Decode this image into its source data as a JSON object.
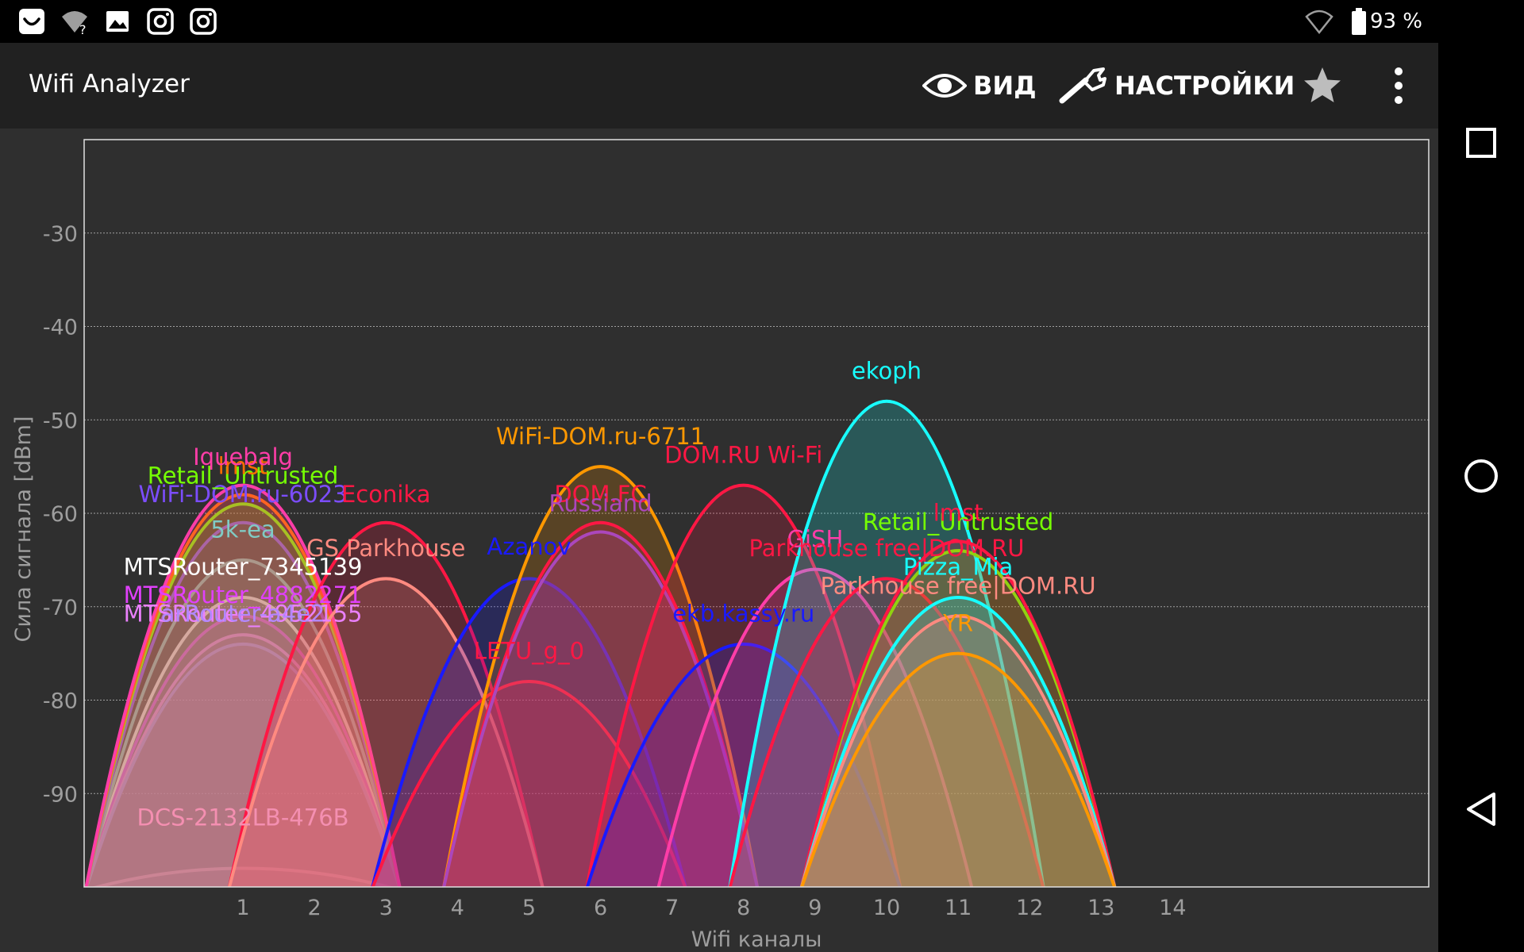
{
  "status_bar": {
    "battery_percent": "93 %",
    "icons": [
      "smile-app-icon",
      "wifi-question-icon",
      "image-icon",
      "instagram-icon",
      "instagram-icon",
      "wifi-outline-icon",
      "battery-icon"
    ]
  },
  "toolbar": {
    "title": "Wifi Analyzer",
    "view_label": "ВИД",
    "settings_label": "НАСТРОЙКИ",
    "icons": {
      "view": "eye-icon",
      "settings": "wrench-icon",
      "favorite": "star-icon",
      "more": "more-vert-icon"
    }
  },
  "nav_bar": {
    "icons": [
      "recents-square-icon",
      "home-circle-icon",
      "back-triangle-icon"
    ]
  },
  "chart_data": {
    "type": "area",
    "xlabel": "Wifi каналы",
    "ylabel": "Сила сигнала [dBm]",
    "x_ticks": [
      1,
      2,
      3,
      4,
      5,
      6,
      7,
      8,
      9,
      10,
      11,
      12,
      13,
      14
    ],
    "y_ticks": [
      -30,
      -40,
      -50,
      -60,
      -70,
      -80,
      -90
    ],
    "xlim": [
      -1.22,
      17.58
    ],
    "ylim": [
      -100,
      -20
    ],
    "grid": true,
    "series": [
      {
        "name": "DCS-2132LB-476B",
        "channel": 1,
        "signal": -98,
        "color": "#f48fb1",
        "label_y": -93.4
      },
      {
        "name": "MTSRouter_7345139",
        "channel": 1,
        "signal": -69,
        "color": "#ffffff",
        "label_y": -66.6
      },
      {
        "name": "MTSRouter_4882271",
        "channel": 1,
        "signal": -71,
        "color": "#e040fb",
        "label_y": -69.6
      },
      {
        "name": "MTSRouter_4952155",
        "channel": 1,
        "signal": -73,
        "color": "#ea80fc",
        "label_y": -71.6
      },
      {
        "name": "arRouter-a4e2",
        "channel": 1,
        "signal": -74,
        "color": "#b388ff",
        "label_y": -71.6
      },
      {
        "name": "5k-ea",
        "channel": 1,
        "signal": -65,
        "color": "#80cbc4",
        "label_y": -62.6
      },
      {
        "name": "WiFi-DOM.ru-6023",
        "channel": 1,
        "signal": -61,
        "color": "#7c4dff",
        "label_y": -58.8
      },
      {
        "name": "Retail_Untrusted",
        "channel": 1,
        "signal": -59,
        "color": "#76ff03",
        "label_y": -56.8
      },
      {
        "name": "lmst",
        "channel": 1,
        "signal": -58,
        "color": "#ff6d00",
        "label_y": -55.8
      },
      {
        "name": "Iquebalg",
        "channel": 1,
        "signal": -57,
        "color": "#ff3da8",
        "label_y": -54.8
      },
      {
        "name": "Econika",
        "channel": 3,
        "signal": -61,
        "color": "#ff1744",
        "label_y": -58.8
      },
      {
        "name": "GS Parkhouse",
        "channel": 3,
        "signal": -67,
        "color": "#ff8a80",
        "label_y": -64.6
      },
      {
        "name": "Azanov",
        "channel": 5,
        "signal": -67,
        "color": "#1a1aff",
        "label_y": -64.4
      },
      {
        "name": "LETU_g_0",
        "channel": 5,
        "signal": -78,
        "color": "#ff1744",
        "label_y": -75.6
      },
      {
        "name": "WiFi-DOM.ru-6711",
        "channel": 6,
        "signal": -55,
        "color": "#ff9800",
        "label_y": -52.6
      },
      {
        "name": "DOM.FC",
        "channel": 6,
        "signal": -61,
        "color": "#ff1744",
        "label_y": -58.8
      },
      {
        "name": "Russiand",
        "channel": 6,
        "signal": -62,
        "color": "#ab47bc",
        "label_y": -59.8
      },
      {
        "name": "DOM.RU Wi-Fi",
        "channel": 8,
        "signal": -57,
        "color": "#ff1744",
        "label_y": -54.6
      },
      {
        "name": "ekb.kassy.ru",
        "channel": 8,
        "signal": -74,
        "color": "#1a1aff",
        "label_y": -71.6
      },
      {
        "name": "GiSH",
        "channel": 9,
        "signal": -66,
        "color": "#ff3da8",
        "label_y": -63.6
      },
      {
        "name": "ekoph",
        "channel": 10,
        "signal": -48,
        "color": "#18ffff",
        "label_y": -45.6
      },
      {
        "name": "Parkhouse free|DOM.RU",
        "channel": 10,
        "signal": -67,
        "color": "#ff1744",
        "label_y": -64.6
      },
      {
        "name": "Retail_Untrusted",
        "channel": 11,
        "signal": -64,
        "color": "#76ff03",
        "label_y": -61.8
      },
      {
        "name": "lmst",
        "channel": 11,
        "signal": -63,
        "color": "#ff1744",
        "label_y": -60.8
      },
      {
        "name": "Pizza_Mia",
        "channel": 11,
        "signal": -69,
        "color": "#18ffff",
        "label_y": -66.6
      },
      {
        "name": "Parkhouse free|DOM.RU",
        "channel": 11,
        "signal": -71,
        "color": "#ff8a80",
        "label_y": -68.6
      },
      {
        "name": "YR",
        "channel": 11,
        "signal": -75,
        "color": "#ff9800",
        "label_y": -72.6
      }
    ]
  }
}
